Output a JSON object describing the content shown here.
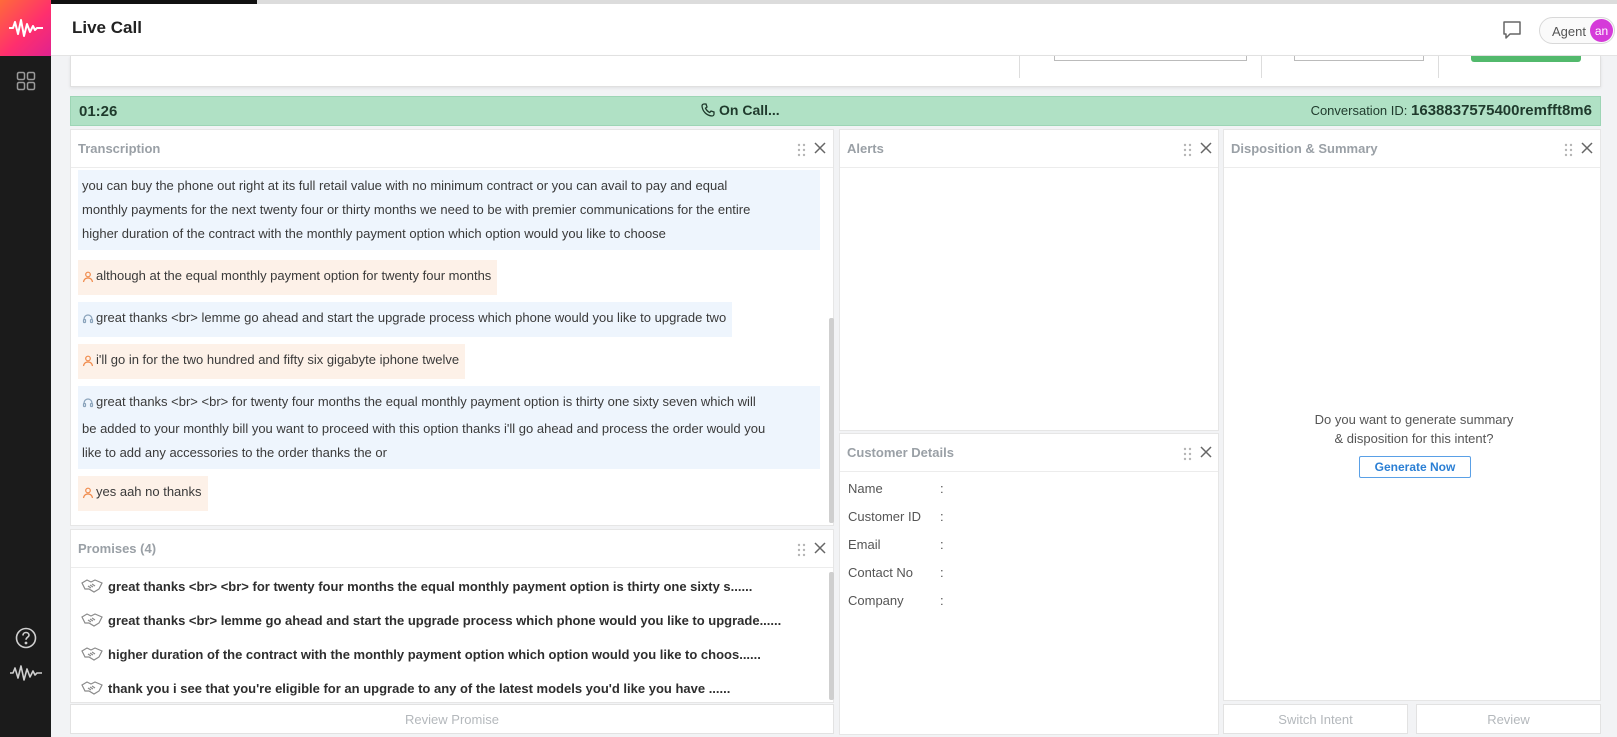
{
  "header": {
    "title": "Live Call",
    "agent_label": "Agent",
    "avatar_initials": "an"
  },
  "status": {
    "timer": "01:26",
    "state": "On Call...",
    "conversation_label": "Conversation ID:",
    "conversation_id": "1638837575400remfft8m6"
  },
  "transcription": {
    "title": "Transcription",
    "messages": [
      {
        "speaker": "agent",
        "lines": [
          "you can buy the phone out right at its full retail value with no minimum contract or you can avail to pay and equal",
          "monthly payments for the next twenty four or thirty months we need to be with premier communications for the entire",
          "higher duration of the contract with the monthly payment option which option would you like to choose"
        ]
      },
      {
        "speaker": "customer",
        "lines": [
          "although at the equal monthly payment option for twenty four months"
        ]
      },
      {
        "speaker": "agent",
        "lines": [
          "great thanks <br> lemme go ahead and start the upgrade process which phone would you like to upgrade two"
        ]
      },
      {
        "speaker": "customer",
        "lines": [
          "i'll go in for the two hundred and fifty six gigabyte iphone twelve"
        ]
      },
      {
        "speaker": "agent",
        "lines": [
          "great thanks <br> <br> for twenty four months the equal monthly payment option is thirty one sixty seven which will",
          "be added to your monthly bill you want to proceed with this option thanks i'll go ahead and process the order would you",
          "like to add any accessories to the order thanks the or"
        ]
      },
      {
        "speaker": "customer",
        "lines": [
          "yes aah no thanks"
        ]
      }
    ]
  },
  "promises": {
    "title": "Promises (4)",
    "items": [
      "great thanks <br> <br> for twenty four months the equal monthly payment option is thirty one sixty s......",
      "great thanks <br> lemme go ahead and start the upgrade process which phone would you like to upgrade......",
      "higher duration of the contract with the monthly payment option which option would you like to choos......",
      "thank you i see that you're eligible for an upgrade to any of the latest models you'd like you have ......"
    ],
    "review_label": "Review Promise"
  },
  "alerts": {
    "title": "Alerts"
  },
  "customer_details": {
    "title": "Customer Details",
    "fields": [
      {
        "label": "Name",
        "value": ""
      },
      {
        "label": "Customer ID",
        "value": ""
      },
      {
        "label": "Email",
        "value": ""
      },
      {
        "label": "Contact No",
        "value": ""
      },
      {
        "label": "Company",
        "value": ""
      }
    ],
    "separator": ":"
  },
  "disposition": {
    "title": "Disposition & Summary",
    "question_line1": "Do you want to generate summary",
    "question_line2": "& disposition for this intent?",
    "generate_label": "Generate Now",
    "switch_intent_label": "Switch Intent",
    "review_label": "Review"
  },
  "colors": {
    "status_bar": "#b0e1c5",
    "brand_gradient_start": "#ff6a3a",
    "brand_gradient_end": "#e0228f",
    "avatar": "#d53ad9",
    "agent_bubble": "#eef5fd",
    "customer_bubble": "#fdf1e8",
    "link_blue": "#2b7fd4"
  },
  "icons": {
    "rail_logo": "waveform-logo-icon",
    "rail_apps": "grid-apps-icon",
    "rail_help": "help-circle-icon",
    "rail_bottom": "waveform-icon",
    "chat": "chat-icon",
    "phone": "phone-icon",
    "drag": "drag-handle-icon",
    "close": "close-icon",
    "agent_msg": "headset-icon",
    "customer_msg": "person-icon",
    "promise": "handshake-icon"
  }
}
